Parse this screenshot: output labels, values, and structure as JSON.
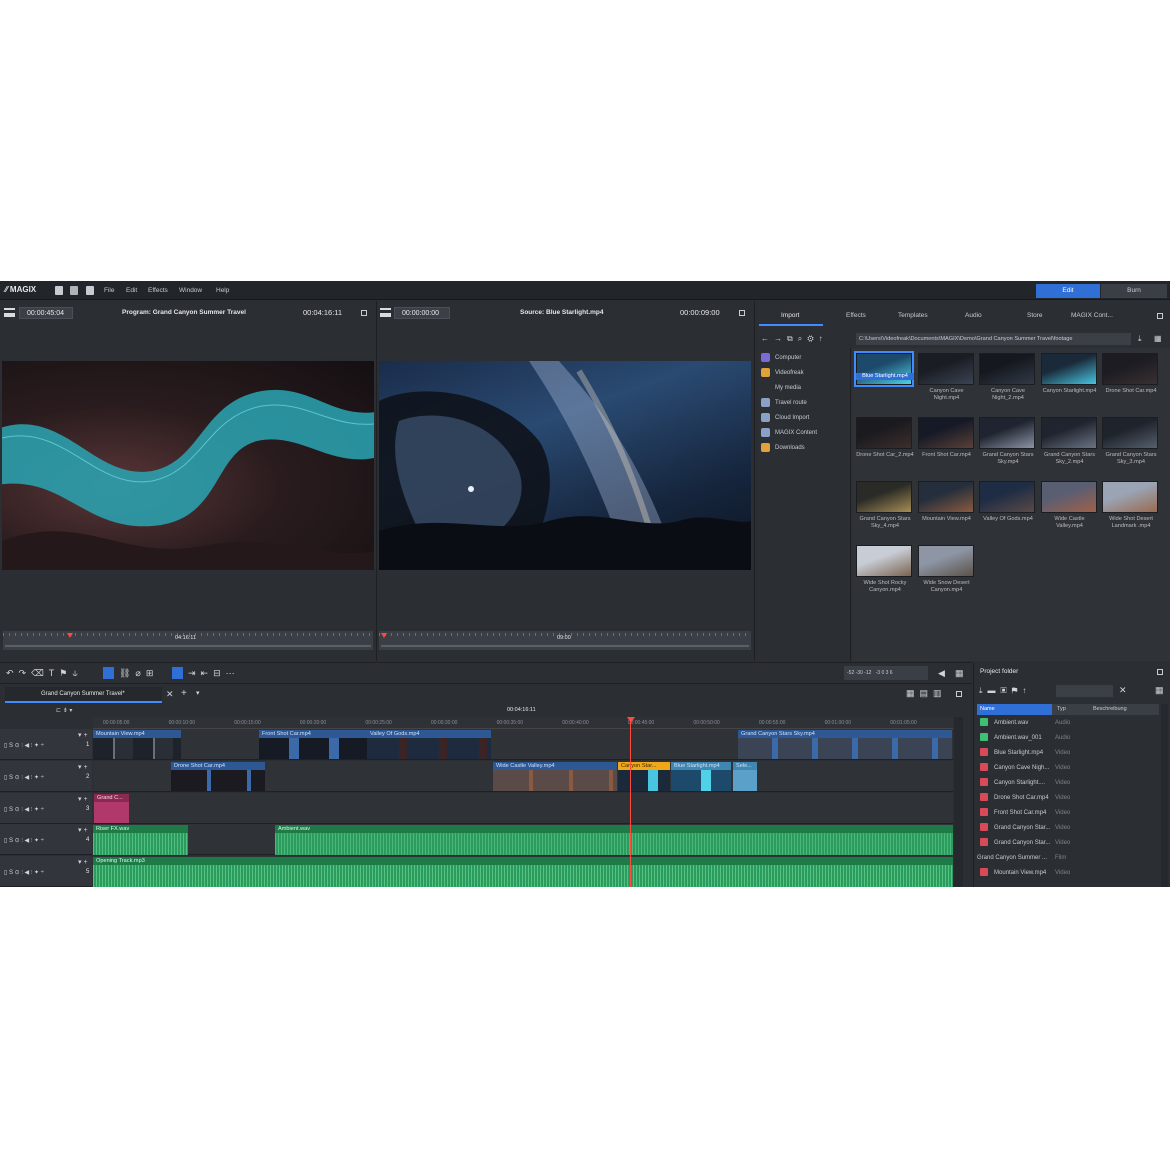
{
  "app": {
    "logo": "MAGIX",
    "menu": [
      "File",
      "Edit",
      "Effects",
      "Window",
      "Help"
    ],
    "modes": {
      "edit": "Edit",
      "burn": "Burn"
    }
  },
  "program": {
    "timecode": "00:00:45:04",
    "title": "Program: Grand Canyon Summer Travel",
    "duration": "00:04:16:11",
    "scrub_label": "04:16:11"
  },
  "source": {
    "timecode": "00:00:00:00",
    "title": "Source: Blue Starlight.mp4",
    "duration": "00:00:09:00",
    "scrub_label": "09:00"
  },
  "controls": {
    "program": "[  ]  |◂  ⊛  ▶  |▸|  ▸|",
    "source": "[  ]  |◂  ◂  ▶  |▸|  ▸|"
  },
  "browser": {
    "tabs": [
      "Import",
      "Effects",
      "Templates",
      "Audio",
      "Store",
      "MAGIX Cont..."
    ],
    "path": "C:\\Users\\Videofreak\\Documents\\MAGIX\\Demo\\Grand Canyon Summer Travel\\footage",
    "nav": [
      {
        "label": "Computer",
        "color": "#7a6bd6"
      },
      {
        "label": "Videofreak",
        "color": "#e0a23a"
      },
      {
        "label": "My media",
        "color": "#2b2e33"
      },
      {
        "label": "Travel route",
        "color": "#8aa0c8"
      },
      {
        "label": "Cloud Import",
        "color": "#8aa0c8"
      },
      {
        "label": "MAGIX Content",
        "color": "#8aa0c8"
      },
      {
        "label": "Downloads",
        "color": "#e0a23a"
      }
    ],
    "files": [
      {
        "name": "Blue Starlight.mp4",
        "c1": "#1d4a6b",
        "c2": "#4fd2e8",
        "selected": true
      },
      {
        "name": "Canyon Cave Night.mp4",
        "c1": "#1a1d24",
        "c2": "#3b4452"
      },
      {
        "name": "Canyon Cave Night_2.mp4",
        "c1": "#15191f",
        "c2": "#323a47"
      },
      {
        "name": "Canyon Starlight.mp4",
        "c1": "#1a2a3a",
        "c2": "#48c5e0"
      },
      {
        "name": "Drone Shot Car.mp4",
        "c1": "#1c1c22",
        "c2": "#3a3032"
      },
      {
        "name": "Drone Shot Car_2.mp4",
        "c1": "#1b1a1f",
        "c2": "#3c2e2c"
      },
      {
        "name": "Front Shot Car.mp4",
        "c1": "#161a26",
        "c2": "#5a4038"
      },
      {
        "name": "Grand Canyon Stars Sky.mp4",
        "c1": "#202430",
        "c2": "#8c94a6"
      },
      {
        "name": "Grand Canyon Stars Sky_2.mp4",
        "c1": "#20242e",
        "c2": "#6b7384"
      },
      {
        "name": "Grand Canyon Stars Sky_3.mp4",
        "c1": "#1f232b",
        "c2": "#55606e"
      },
      {
        "name": "Grand Canyon Stars Sky_4.mp4",
        "c1": "#2a2a26",
        "c2": "#a58e55"
      },
      {
        "name": "Mountain View.mp4",
        "c1": "#252e3c",
        "c2": "#8a5a40"
      },
      {
        "name": "Valley Of Gods.mp4",
        "c1": "#1e2c44",
        "c2": "#5a4a48"
      },
      {
        "name": "Wide Castle Valley.mp4",
        "c1": "#5a5e72",
        "c2": "#a0604a"
      },
      {
        "name": "Wide Shot Desert Landmark .mp4",
        "c1": "#9aa4b4",
        "c2": "#9a6a50"
      },
      {
        "name": "Wide Shot Rocky Canyon.mp4",
        "c1": "#c8ccd4",
        "c2": "#7a6450"
      },
      {
        "name": "Wide Snow Desert Canyon.mp4",
        "c1": "#8e96a6",
        "c2": "#5a5248"
      }
    ]
  },
  "timeline": {
    "tab": "Grand Canyon Summer Travel*",
    "current": "00:04:16:11",
    "ruler": [
      "00:00:05:00",
      "00:00:10:00",
      "00:00:15:00",
      "00:00:20:00",
      "00:00:25:00",
      "00:00:30:00",
      "00:00:35:00",
      "00:00:40:00",
      "00:00:45:00",
      "00:00:50:00",
      "00:00:55:00",
      "00:01:00:00",
      "00:01:05:00"
    ],
    "track_ctl": "▯ S ⊙ ⫶ ◀ ⫶ ✦ ÷",
    "tracks": [
      "1",
      "2",
      "3",
      "4",
      "5"
    ],
    "clips": {
      "t1a": "Mountain View.mp4",
      "t1b": "Front Shot Car.mp4",
      "t1c": "Valley Of Gods.mp4",
      "t1d": "Grand Canyon Stars Sky.mp4",
      "t2a": "Drone Shot Car.mp4",
      "t2b": "Wide Castle Valley.mp4",
      "t2c": "Canyon Star...",
      "t2d": "Blue Starlight.mp4",
      "t2e": "Sele...",
      "t3a": "Grand C...",
      "t4a": "Riser FX.wav",
      "t4b": "Ambient.wav",
      "t5a": "Opening Track.mp3"
    }
  },
  "project": {
    "title": "Project folder",
    "cols": [
      "Name",
      "Typ",
      "Beschreibung"
    ],
    "rows": [
      {
        "name": "Ambient.wav",
        "typ": "Audio",
        "color": "#3fbf73"
      },
      {
        "name": "Ambient.wav_001",
        "typ": "Audio",
        "color": "#3fbf73"
      },
      {
        "name": "Blue Starlight.mp4",
        "typ": "Video",
        "color": "#d84a58"
      },
      {
        "name": "Canyon Cave Nigh...",
        "typ": "Video",
        "color": "#d84a58"
      },
      {
        "name": "Canyon Starlight....",
        "typ": "Video",
        "color": "#d84a58"
      },
      {
        "name": "Drone Shot Car.mp4",
        "typ": "Video",
        "color": "#d84a58"
      },
      {
        "name": "Front Shot Car.mp4",
        "typ": "Video",
        "color": "#d84a58"
      },
      {
        "name": "Grand Canyon Star...",
        "typ": "Video",
        "color": "#d84a58"
      },
      {
        "name": "Grand Canyon Star...",
        "typ": "Video",
        "color": "#d84a58"
      },
      {
        "name": "Grand Canyon Summer ...",
        "typ": "Film",
        "color": ""
      },
      {
        "name": "Mountain View.mp4",
        "typ": "Video",
        "color": "#d84a58"
      }
    ]
  }
}
